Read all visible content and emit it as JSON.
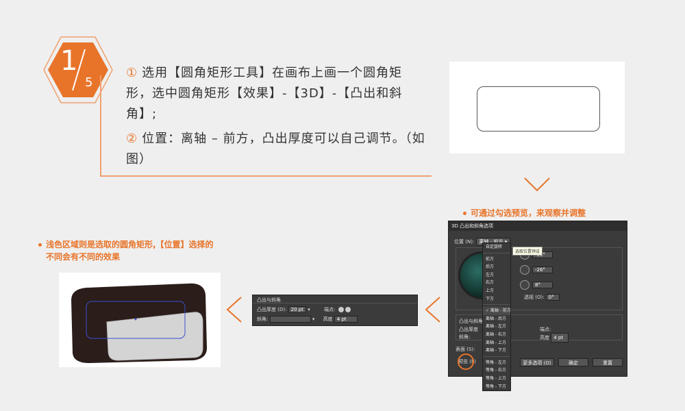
{
  "step": {
    "current": "1",
    "total": "5"
  },
  "instructions": [
    {
      "num": "①",
      "text": "选用【圆角矩形工具】在画布上画一个圆角矩形，选中圆角矩形【效果】-【3D】-【凸出和斜角】;"
    },
    {
      "num": "②",
      "text": "位置：离轴 – 前方，凸出厚度可以自己调节。（如图）"
    }
  ],
  "notes": {
    "right": "可通过勾选预览，来观察并调整",
    "left_line1": "浅色区域则是选取的圆角矩形,【位置】选择的",
    "left_line2": "不同会有不同的效果"
  },
  "dialog": {
    "title": "3D 凸出和斜角选项",
    "position_label": "位置 (N):",
    "position_value": "离轴 - 前方",
    "angle_x": "-18°",
    "angle_y": "-26°",
    "angle_z": "8°",
    "perspective_label": "透视 (O):",
    "perspective_value": "0°",
    "extrude_title": "凸出与斜角",
    "extrude_depth_label": "凸出厚度",
    "cap_label": "端点:",
    "bevel_label": "斜角:",
    "height_label": "高度",
    "height_value": "4 pt",
    "surface_label": "表面 (S):",
    "preview_label": "预览 (P)",
    "more_options": "更多选项 (O)",
    "ok": "确定",
    "reset": "重置",
    "tooltip": "选取位置预设",
    "menu": [
      "自定旋转",
      "前方",
      "后方",
      "左方",
      "右方",
      "上方",
      "下方",
      "离轴 - 前方",
      "离轴 - 后方",
      "离轴 - 左方",
      "离轴 - 右方",
      "离轴 - 上方",
      "离轴 - 下方",
      "等角 - 左方",
      "等角 - 右方",
      "等角 - 上方",
      "等角 - 下方"
    ],
    "checked_index": 7
  },
  "mini_panel": {
    "title": "凸出与斜角",
    "depth_label": "凸出厚度 (D):",
    "depth_value": "20 pt",
    "cap_label": "端点:",
    "bevel_label": "斜角:",
    "height_label": "高度",
    "height_value": "4 pt"
  },
  "colors": {
    "accent": "#e8742a",
    "accent_light": "#f0a070"
  }
}
